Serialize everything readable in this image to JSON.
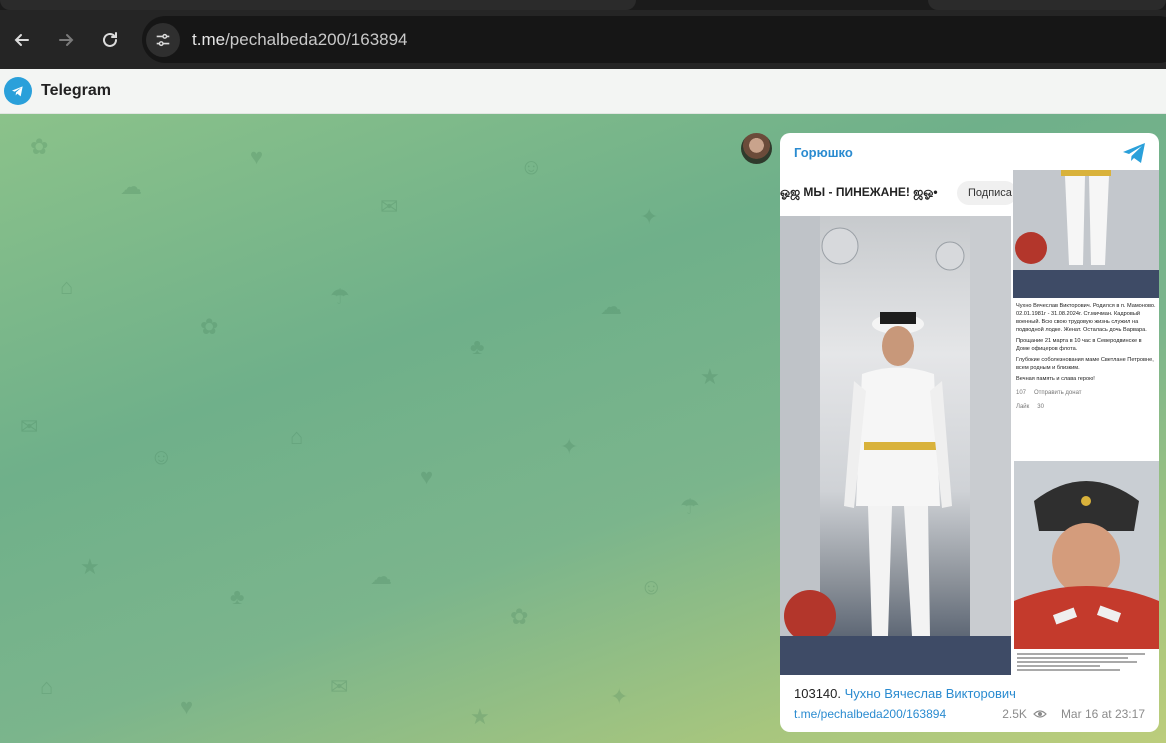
{
  "browser": {
    "url_host": "t.me",
    "url_path": "/pechalbeda200/163894"
  },
  "header": {
    "app_title": "Telegram"
  },
  "post": {
    "author": "Горюшко",
    "media": {
      "source_title": "ஓஜ МЫ - ПИНЕЖАНЕ! ஜஓ•",
      "subscribe_label": "Подписа",
      "doc_text": [
        "Чухно Вячеслав Викторович. Родился в п. Мамоново. 02.01.1981г - 31.08.2024г. Ст.мичман. Кадровый военный. Всю свою трудовую жизнь служил на подводной лодке. Женат. Осталась дочь Варвара.",
        "Прощание 21 марта в 10 час в Северодвинске в Доме офицеров флота.",
        "Глубокие соболезнования маме Светлане Петровне, всем родным и близким.",
        "Вечная память и слава герою!"
      ],
      "doc_reactions": "107",
      "doc_send": "Отправить донат",
      "doc_like": "Лайк",
      "doc_share_count": "30"
    },
    "caption_number": "103140.",
    "caption_name": "Чухно Вячеслав Викторович",
    "link": "t.me/pechalbeda200/163894",
    "views": "2.5K",
    "date": "Mar 16 at 23:17"
  },
  "colors": {
    "accent": "#2a8bd0",
    "telegram_blue": "#2aa0da"
  }
}
